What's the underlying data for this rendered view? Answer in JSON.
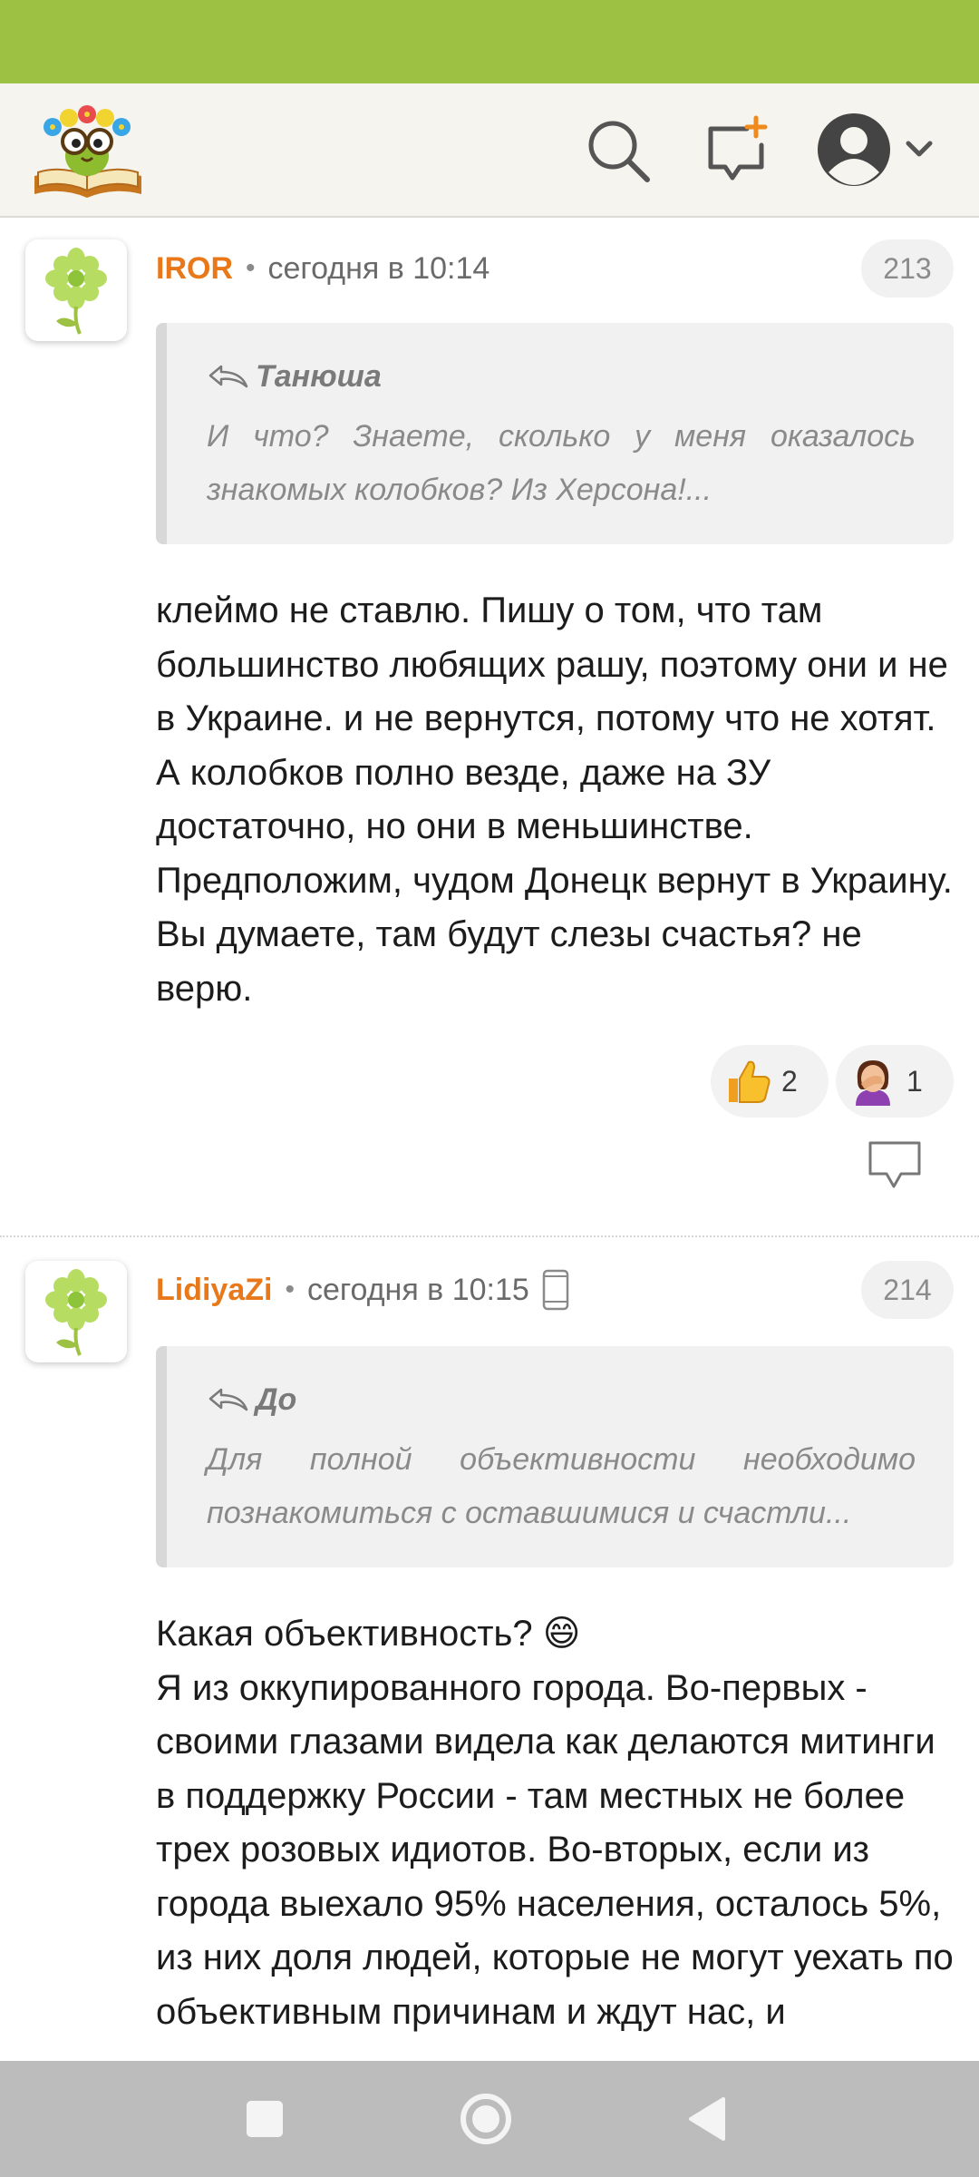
{
  "header": {
    "logo_icon": "book-owl-logo-icon",
    "search_icon": "search-icon",
    "new_post_icon": "new-post-icon",
    "profile_icon": "avatar-icon",
    "menu_icon": "chevron-down-icon"
  },
  "comments": [
    {
      "author": "IROR",
      "separator": "•",
      "time": "сегодня в 10:14",
      "number": "213",
      "quote": {
        "author": "Танюша",
        "text": "И что? Знаете, сколько у меня оказалось знакомых колобков? Из Херсона!..."
      },
      "body": "клеймо не ставлю. Пишу о том, что там большинство любящих рашу, поэтому они и не в Украине. и не вернутся, потому что не хотят. А колобков полно везде, даже на ЗУ достаточно, но они в меньшинстве. Предположим, чудом Донецк вернут в Украину. Вы думаете, там будут слезы счастья? не верю.",
      "reactions": [
        {
          "icon": "thumbs-up",
          "emoji": "👍",
          "count": "2"
        },
        {
          "icon": "facepalm",
          "emoji": "🤦‍♀️",
          "count": "1"
        }
      ]
    },
    {
      "author": "LidiyaZi",
      "separator": "•",
      "time": "сегодня в 10:15",
      "device_icon": "mobile-phone-icon",
      "number": "214",
      "quote": {
        "author": "До",
        "text": "Для полной объективности необходимо познакомиться с оставшимися и счастли..."
      },
      "body_lines": [
        "Какая объективность? 😄",
        "Я из оккупированного города. Во-первых - своими глазами видела как делаются митинги в поддержку России - там местных не более трех розовых идиотов. Во-вторых, если из города выехало 95% населения, осталось 5%, из них доля людей, которые не могут уехать по объективным причинам и ждут нас, и"
      ]
    }
  ],
  "navigation": {
    "recents_icon": "square-recents-icon",
    "home_icon": "circle-home-icon",
    "back_icon": "triangle-back-icon"
  },
  "colors": {
    "status_bar": "#9dc243",
    "header_bg": "#f5f4ee",
    "author": "#e8781a",
    "quote_bg": "#f1f1f1",
    "nav_bar": "#bcbcbc"
  }
}
